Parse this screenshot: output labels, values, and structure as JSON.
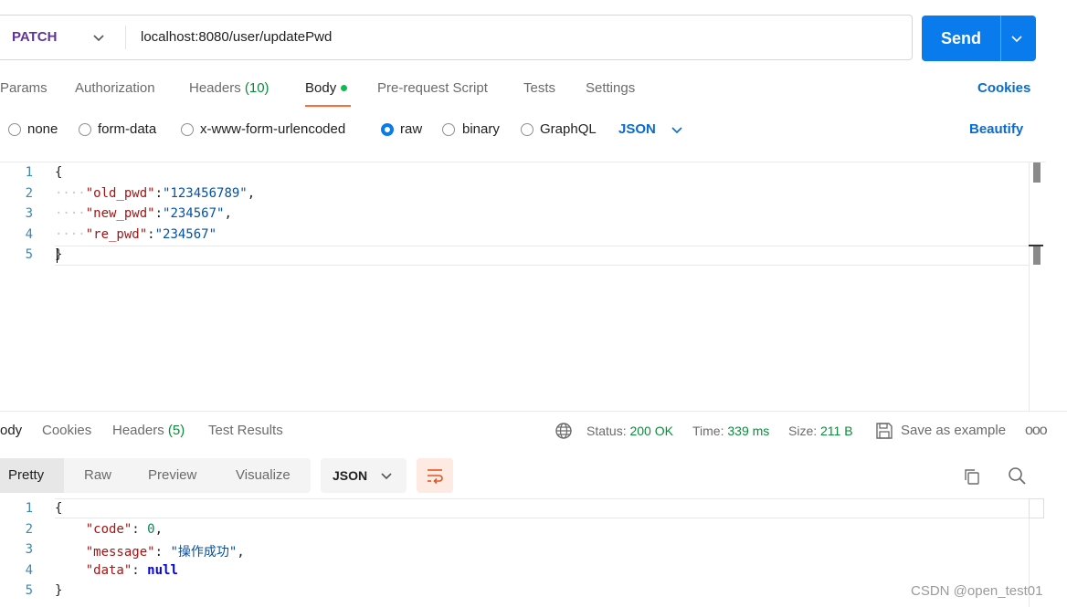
{
  "request": {
    "method": "PATCH",
    "url": "localhost:8080/user/updatePwd",
    "send_label": "Send"
  },
  "request_tabs": [
    {
      "label": "Params"
    },
    {
      "label": "Authorization"
    },
    {
      "label": "Headers",
      "count": "(10)"
    },
    {
      "label": "Body"
    },
    {
      "label": "Pre-request Script"
    },
    {
      "label": "Tests"
    },
    {
      "label": "Settings"
    }
  ],
  "active_request_tab": "Body",
  "cookies_label": "Cookies",
  "body_types": [
    {
      "label": "none",
      "selected": false
    },
    {
      "label": "form-data",
      "selected": false
    },
    {
      "label": "x-www-form-urlencoded",
      "selected": false
    },
    {
      "label": "raw",
      "selected": true
    },
    {
      "label": "binary",
      "selected": false
    },
    {
      "label": "GraphQL",
      "selected": false
    }
  ],
  "raw_format": "JSON",
  "beautify_label": "Beautify",
  "request_body": {
    "line_numbers": [
      "1",
      "2",
      "3",
      "4",
      "5"
    ],
    "open_brace": "{",
    "close_brace": "}",
    "fields": [
      {
        "key": "\"old_pwd\"",
        "value": "\"123456789\"",
        "sep": ","
      },
      {
        "key": "\"new_pwd\"",
        "value": "\"234567\"",
        "sep": ","
      },
      {
        "key": "\"re_pwd\"",
        "value": "\"234567\"",
        "sep": ""
      }
    ]
  },
  "response_tabs": [
    {
      "label": "ody"
    },
    {
      "label": "Cookies"
    },
    {
      "label": "Headers",
      "count": "(5)"
    },
    {
      "label": "Test Results"
    }
  ],
  "response_meta": {
    "status_label": "Status:",
    "status_value": "200 OK",
    "time_label": "Time:",
    "time_value": "339 ms",
    "size_label": "Size:",
    "size_value": "211 B",
    "save_label": "Save as example",
    "more_label": "ooo"
  },
  "view_modes": [
    {
      "label": "Pretty",
      "active": true
    },
    {
      "label": "Raw",
      "active": false
    },
    {
      "label": "Preview",
      "active": false
    },
    {
      "label": "Visualize",
      "active": false
    }
  ],
  "response_format": "JSON",
  "response_body": {
    "line_numbers": [
      "1",
      "2",
      "3",
      "4",
      "5"
    ],
    "open_brace": "{",
    "close_brace": "}",
    "code_key": "\"code\"",
    "code_value": "0",
    "message_key": "\"message\"",
    "message_value": "\"操作成功\"",
    "data_key": "\"data\"",
    "data_value": "null"
  },
  "watermark": "CSDN @open_test01",
  "colors": {
    "accent": "#097bed",
    "method": "#623497",
    "active_tab_underline": "#ff6c37",
    "status_ok": "#0c8a3c",
    "link": "#0b6bcb"
  }
}
